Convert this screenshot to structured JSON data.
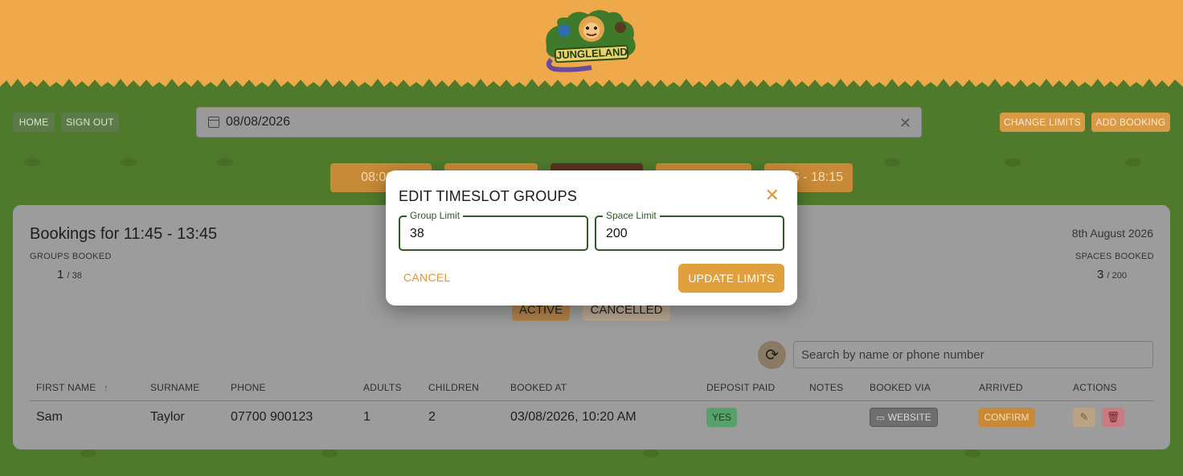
{
  "brand": {
    "logo_text": "JUNGLELAND"
  },
  "nav": {
    "home": "HOME",
    "sign_out": "SIGN OUT",
    "change_limits": "CHANGE LIMITS",
    "add_booking": "ADD BOOKING"
  },
  "date_picker": {
    "value": "08/08/2026",
    "clear_icon": "close-icon"
  },
  "timeslots": [
    "08:00 - ",
    "",
    "",
    "",
    "5 - 18:15"
  ],
  "bookings": {
    "title": "Bookings for 11:45 - 13:45",
    "date_label": "8th August 2026",
    "groups_booked_label": "GROUPS BOOKED",
    "groups_booked_value": "1",
    "groups_booked_limit": "/ 38",
    "spaces_booked_label": "SPACES BOOKED",
    "spaces_booked_value": "3",
    "spaces_booked_limit": "/ 200",
    "filters": {
      "active": "ACTIVE",
      "cancelled": "CANCELLED"
    },
    "search_placeholder": "Search by name or phone number",
    "columns": [
      "FIRST NAME",
      "SURNAME",
      "PHONE",
      "ADULTS",
      "CHILDREN",
      "BOOKED AT",
      "DEPOSIT PAID",
      "NOTES",
      "BOOKED VIA",
      "ARRIVED",
      "ACTIONS"
    ],
    "sort_indicator": "↑",
    "rows": [
      {
        "first_name": "Sam",
        "surname": "Taylor",
        "phone": "07700 900123",
        "adults": "1",
        "children": "2",
        "booked_at": "03/08/2026, 10:20 AM",
        "deposit_paid": "YES",
        "booked_via": "WEBSITE",
        "arrived": "CONFIRM"
      }
    ]
  },
  "modal": {
    "title": "EDIT TIMESLOT GROUPS",
    "group_limit_label": "Group Limit",
    "group_limit_value": "38",
    "space_limit_label": "Space Limit",
    "space_limit_value": "200",
    "cancel": "CANCEL",
    "update": "UPDATE LIMITS"
  },
  "colors": {
    "header": "#f0a94a",
    "grass": "#4f7a2c",
    "accent": "#e0a03e",
    "field_border": "#2f5a24"
  }
}
